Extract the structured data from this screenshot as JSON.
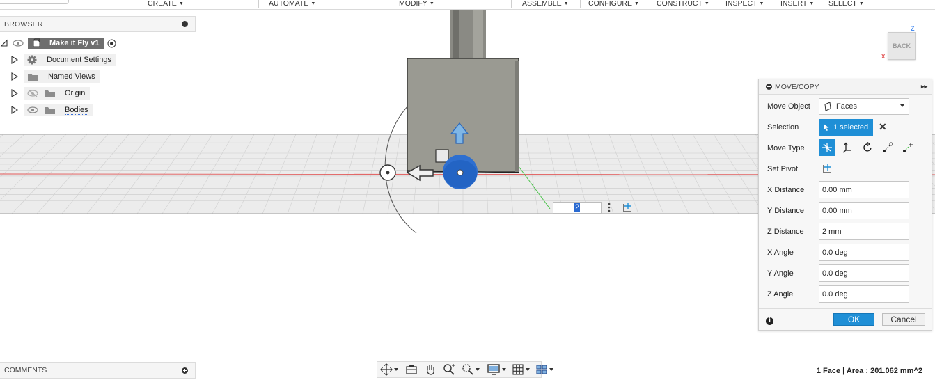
{
  "toolbar": {
    "menus": [
      {
        "id": "create",
        "label": "CREATE"
      },
      {
        "id": "automate",
        "label": "AUTOMATE"
      },
      {
        "id": "modify",
        "label": "MODIFY"
      },
      {
        "id": "assemble",
        "label": "ASSEMBLE"
      },
      {
        "id": "configure",
        "label": "CONFIGURE"
      },
      {
        "id": "construct",
        "label": "CONSTRUCT"
      },
      {
        "id": "inspect",
        "label": "INSPECT"
      },
      {
        "id": "insert",
        "label": "INSERT"
      },
      {
        "id": "select",
        "label": "SELECT"
      }
    ]
  },
  "browser": {
    "title": "BROWSER",
    "root": {
      "label": "Make it Fly v1",
      "icon": "component-icon"
    },
    "items": [
      {
        "label": "Document Settings",
        "icon": "gear-icon",
        "visibility": "none"
      },
      {
        "label": "Named Views",
        "icon": "folder-icon",
        "visibility": "none"
      },
      {
        "label": "Origin",
        "icon": "folder-icon",
        "visibility": "hidden"
      },
      {
        "label": "Bodies",
        "icon": "folder-icon",
        "visibility": "visible"
      }
    ]
  },
  "viewcube": {
    "face": "BACK",
    "axis_z": "Z",
    "axis_x": "X"
  },
  "inline_input": {
    "value": "2"
  },
  "dialog": {
    "title": "MOVE/COPY",
    "move_object": {
      "label": "Move Object",
      "value": "Faces"
    },
    "selection": {
      "label": "Selection",
      "value": "1 selected"
    },
    "move_type": {
      "label": "Move Type"
    },
    "set_pivot": {
      "label": "Set Pivot"
    },
    "fields": [
      {
        "label": "X Distance",
        "value": "0.00 mm"
      },
      {
        "label": "Y Distance",
        "value": "0.00 mm"
      },
      {
        "label": "Z Distance",
        "value": "2 mm"
      },
      {
        "label": "X Angle",
        "value": "0.0 deg"
      },
      {
        "label": "Y Angle",
        "value": "0.0 deg"
      },
      {
        "label": "Z Angle",
        "value": "0.0 deg"
      }
    ],
    "ok_label": "OK",
    "cancel_label": "Cancel",
    "info_label": "i"
  },
  "comments": {
    "title": "COMMENTS"
  },
  "status": {
    "text": "1 Face | Area : 201.062 mm^2"
  },
  "colors": {
    "accent": "#1f8fd6",
    "x_axis": "#e25656",
    "y_axis": "#3fbf3f",
    "z_axis": "#4a8df0",
    "body": "#9a9a92"
  }
}
